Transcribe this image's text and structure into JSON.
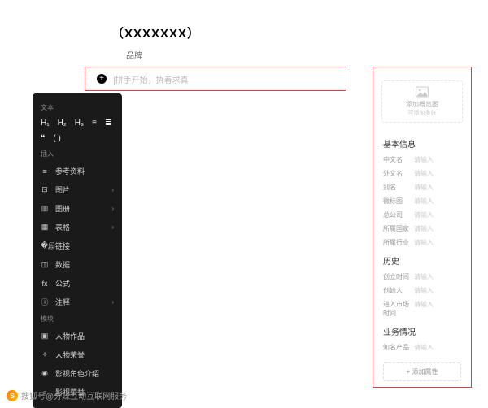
{
  "header": {
    "title": "（XXXXXXX）",
    "tab": "品牌"
  },
  "input": {
    "placeholder": "|拼手开始，执着求真"
  },
  "toolbar": {
    "text_label": "文本",
    "headings": [
      "H₁",
      "H₂",
      "H₃",
      "≡",
      "≣"
    ],
    "quotes": [
      "❝",
      "( )"
    ],
    "insert_label": "插入",
    "insert_items": [
      {
        "icon": "≡",
        "label": "参考资料",
        "sub": false
      },
      {
        "icon": "⊡",
        "label": "图片",
        "sub": true
      },
      {
        "icon": "▥",
        "label": "图册",
        "sub": true
      },
      {
        "icon": "▦",
        "label": "表格",
        "sub": true
      },
      {
        "icon": "�இ",
        "label": "链接",
        "sub": false
      },
      {
        "icon": "◫",
        "label": "数据",
        "sub": false
      },
      {
        "icon": "fx",
        "label": "公式",
        "sub": false
      },
      {
        "icon": "ⓘ",
        "label": "注释",
        "sub": true
      }
    ],
    "module_label": "模块",
    "module_items": [
      {
        "icon": "▣",
        "label": "人物作品",
        "sub": false
      },
      {
        "icon": "✧",
        "label": "人物荣誉",
        "sub": false
      },
      {
        "icon": "◉",
        "label": "影视角色介绍",
        "sub": false
      },
      {
        "icon": "♀",
        "label": "影视荣誉",
        "sub": false
      }
    ]
  },
  "side": {
    "pic_title": "添加概览图",
    "pic_sub": "可添加多张",
    "s1": "基本信息",
    "fields1": [
      {
        "l": "中文名",
        "v": "请输入"
      },
      {
        "l": "外文名",
        "v": "请输入"
      },
      {
        "l": "别名",
        "v": "请输入"
      },
      {
        "l": "徽标图",
        "v": "请输入"
      },
      {
        "l": "总公司",
        "v": "请输入"
      },
      {
        "l": "所属国家",
        "v": "请输入"
      },
      {
        "l": "所属行业",
        "v": "请输入"
      }
    ],
    "s2": "历史",
    "fields2": [
      {
        "l": "创立时间",
        "v": "请输入"
      },
      {
        "l": "创始人",
        "v": "请输入"
      },
      {
        "l": "进入市场时间",
        "v": "请输入"
      }
    ],
    "s3": "业务情况",
    "fields3": [
      {
        "l": "知名产品",
        "v": "请输入"
      }
    ],
    "add": "+ 添加属性"
  },
  "watermark": "搜狐号@分媒互动互联网服务"
}
